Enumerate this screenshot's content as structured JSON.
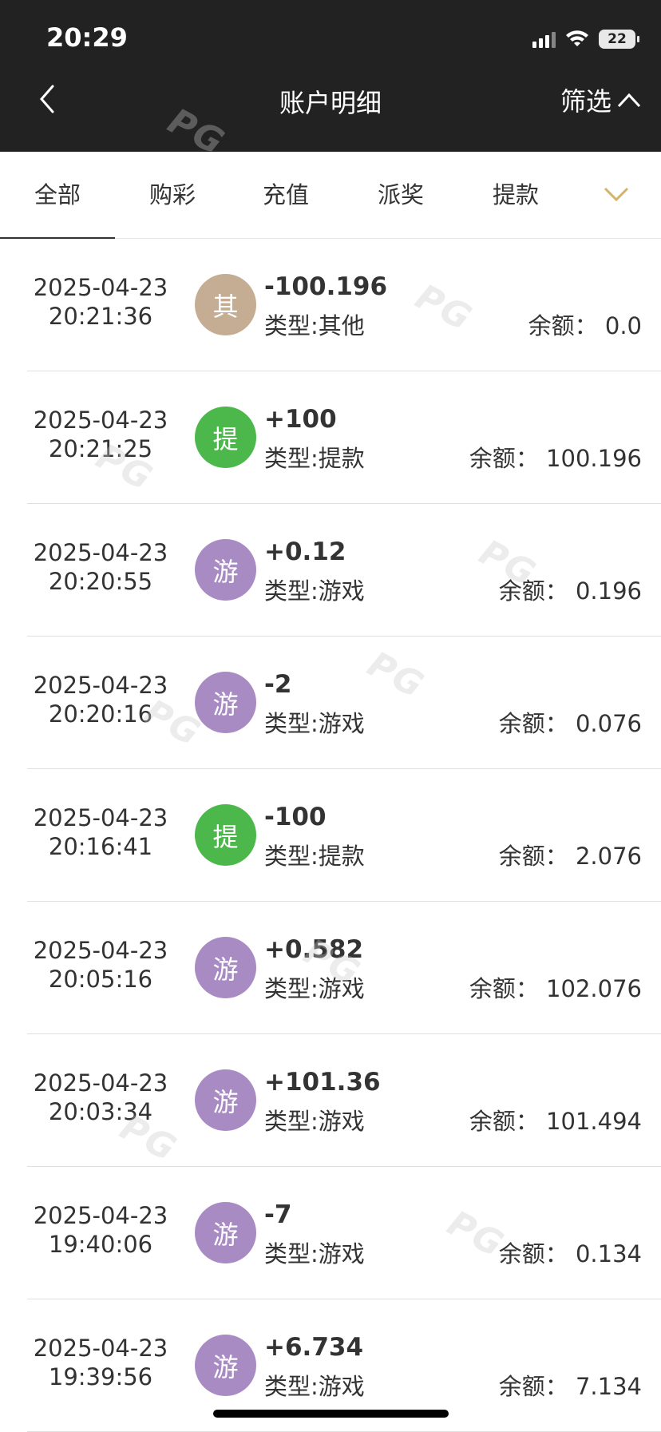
{
  "status_bar": {
    "time": "20:29",
    "battery": "22"
  },
  "header": {
    "title": "账户明细",
    "filter_label": "筛选"
  },
  "tabs": [
    {
      "label": "全部",
      "active": true
    },
    {
      "label": "购彩",
      "active": false
    },
    {
      "label": "充值",
      "active": false
    },
    {
      "label": "派奖",
      "active": false
    },
    {
      "label": "提款",
      "active": false
    }
  ],
  "balance_label": "余额：",
  "records": [
    {
      "date": "2025-04-23",
      "time": "20:21:36",
      "badge": "其",
      "badge_color": "#c4ad92",
      "amount": "-100.196",
      "type": "类型:其他",
      "balance": "余额：  0.0"
    },
    {
      "date": "2025-04-23",
      "time": "20:21:25",
      "badge": "提",
      "badge_color": "#4cb84c",
      "amount": "+100",
      "type": "类型:提款",
      "balance": "余额：  100.196"
    },
    {
      "date": "2025-04-23",
      "time": "20:20:55",
      "badge": "游",
      "badge_color": "#a98bc4",
      "amount": "+0.12",
      "type": "类型:游戏",
      "balance": "余额：  0.196"
    },
    {
      "date": "2025-04-23",
      "time": "20:20:16",
      "badge": "游",
      "badge_color": "#a98bc4",
      "amount": "-2",
      "type": "类型:游戏",
      "balance": "余额：  0.076"
    },
    {
      "date": "2025-04-23",
      "time": "20:16:41",
      "badge": "提",
      "badge_color": "#4cb84c",
      "amount": "-100",
      "type": "类型:提款",
      "balance": "余额：  2.076"
    },
    {
      "date": "2025-04-23",
      "time": "20:05:16",
      "badge": "游",
      "badge_color": "#a98bc4",
      "amount": "+0.582",
      "type": "类型:游戏",
      "balance": "余额：  102.076"
    },
    {
      "date": "2025-04-23",
      "time": "20:03:34",
      "badge": "游",
      "badge_color": "#a98bc4",
      "amount": "+101.36",
      "type": "类型:游戏",
      "balance": "余额：  101.494"
    },
    {
      "date": "2025-04-23",
      "time": "19:40:06",
      "badge": "游",
      "badge_color": "#a98bc4",
      "amount": "-7",
      "type": "类型:游戏",
      "balance": "余额：  0.134"
    },
    {
      "date": "2025-04-23",
      "time": "19:39:56",
      "badge": "游",
      "badge_color": "#a98bc4",
      "amount": "+6.734",
      "type": "类型:游戏",
      "balance": "余额：  7.134"
    }
  ],
  "watermark_text": "PG"
}
